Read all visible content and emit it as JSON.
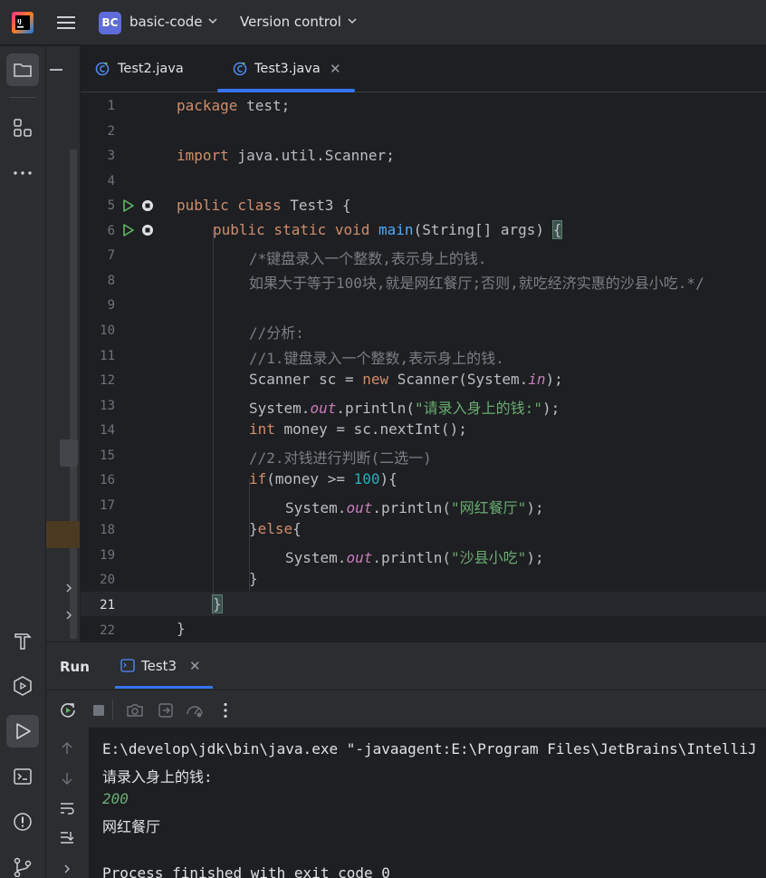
{
  "header": {
    "project_badge": "BC",
    "project_name": "basic-code",
    "vcs_label": "Version control"
  },
  "tabs": [
    {
      "label": "Test2.java",
      "active": false
    },
    {
      "label": "Test3.java",
      "active": true
    }
  ],
  "editor": {
    "current_line": 21,
    "line_numbers": [
      "1",
      "2",
      "3",
      "4",
      "5",
      "6",
      "7",
      "8",
      "9",
      "10",
      "11",
      "12",
      "13",
      "14",
      "15",
      "16",
      "17",
      "18",
      "19",
      "20",
      "21",
      "22"
    ],
    "code": {
      "l1_kw": "package",
      "l1_rest": " test;",
      "l3_kw": "import",
      "l3_rest": " java.util.Scanner;",
      "l5_kw": "public class",
      "l5_rest": " Test3 {",
      "l6_kw": "public static void",
      "l6_fn": "main",
      "l6_rest": "(String[] args) ",
      "l6_brace": "{",
      "l7": "/*键盘录入一个整数,表示身上的钱.",
      "l8": "如果大于等于100块,就是网红餐厅;否则,就吃经济实惠的沙县小吃.*/",
      "l10": "//分析:",
      "l11": "//1.键盘录入一个整数,表示身上的钱.",
      "l12_a": "Scanner sc = ",
      "l12_kw": "new",
      "l12_b": " Scanner(System.",
      "l12_it": "in",
      "l12_c": ");",
      "l13_a": "System.",
      "l13_it": "out",
      "l13_b": ".println(",
      "l13_st": "\"请录入身上的钱:\"",
      "l13_c": ");",
      "l14_kw": "int",
      "l14_rest": " money = sc.nextInt();",
      "l15": "//2.对钱进行判断(二选一)",
      "l16_kw": "if",
      "l16_a": "(money >= ",
      "l16_num": "100",
      "l16_b": "){",
      "l17_a": "System.",
      "l17_it": "out",
      "l17_b": ".println(",
      "l17_st": "\"网红餐厅\"",
      "l17_c": ");",
      "l18_a": "}",
      "l18_kw": "else",
      "l18_b": "{",
      "l19_a": "System.",
      "l19_it": "out",
      "l19_b": ".println(",
      "l19_st": "\"沙县小吃\"",
      "l19_c": ");",
      "l20": "}",
      "l21": "}",
      "l22": "}"
    }
  },
  "run": {
    "title": "Run",
    "tab_label": "Test3",
    "console": {
      "cmd": "E:\\develop\\jdk\\bin\\java.exe \"-javaagent:E:\\Program Files\\JetBrains\\IntelliJ",
      "prompt": "请录入身上的钱:",
      "input": "200",
      "output": "网红餐厅",
      "exit": "Process finished with exit code 0"
    }
  },
  "colors": {
    "accent": "#3574f0",
    "run_green": "#5fb865",
    "keyword": "#cf8e6d",
    "string": "#6aab73",
    "number": "#2aacb8",
    "comment": "#7a7e85"
  }
}
